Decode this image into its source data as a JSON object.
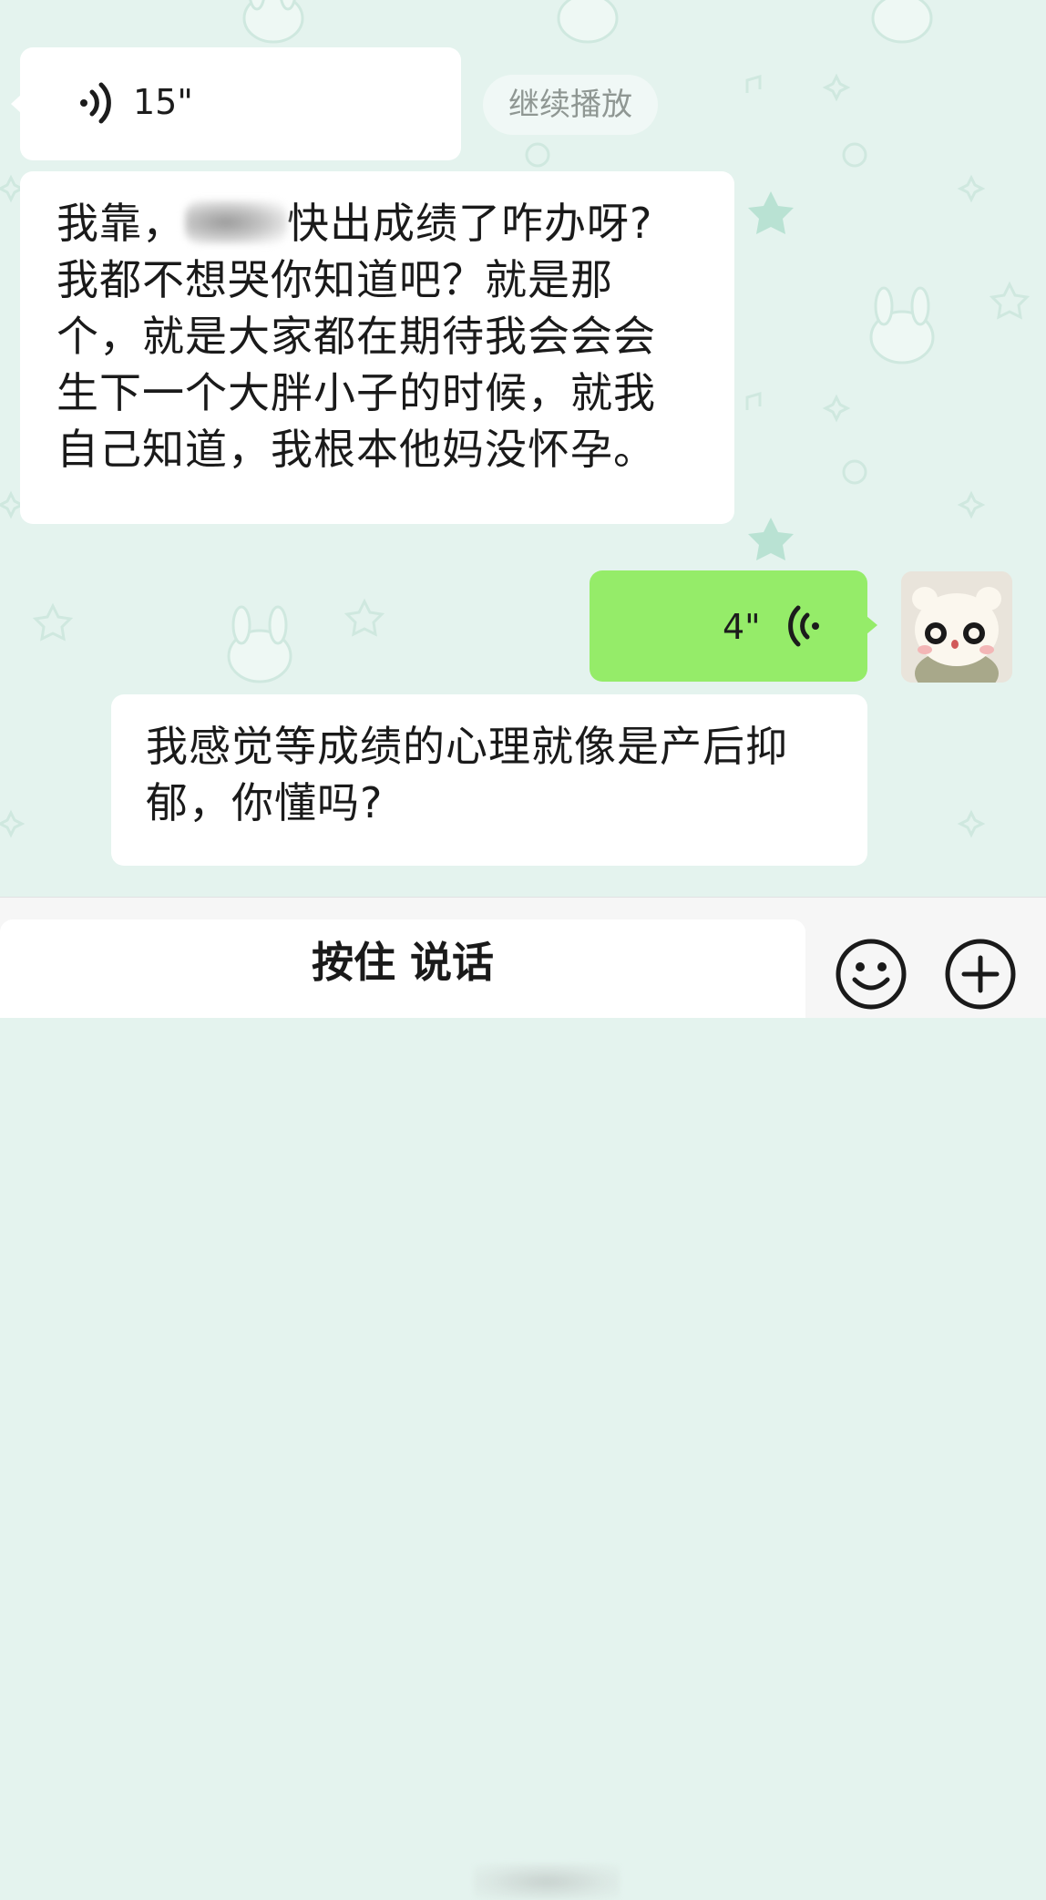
{
  "chat": {
    "incoming_voice": {
      "duration": "15\"",
      "continue_label": "继续播放"
    },
    "message1": {
      "line1_before": "我靠，",
      "line1_after": "快出成绩了咋办呀?",
      "line2": "我都不想哭你知道吧？就是那",
      "line3": "个，就是大家都在期待我会会会",
      "line4": "生下一个大胖小子的时候，就我",
      "line5": "自己知道，我根本他妈没怀孕。"
    },
    "outgoing_voice": {
      "duration": "4\""
    },
    "message2": {
      "line1": "我感觉等成绩的心理就像是产后抑",
      "line2": "郁，你懂吗?"
    }
  },
  "input_bar": {
    "hold_to_talk_label": "按住 说话"
  },
  "colors": {
    "background": "#e4f3ee",
    "bubble_incoming": "#ffffff",
    "bubble_outgoing": "#95ec69",
    "text": "#1a1a1a"
  },
  "icons": [
    "voice-wave-icon",
    "emoji-icon",
    "plus-icon"
  ]
}
